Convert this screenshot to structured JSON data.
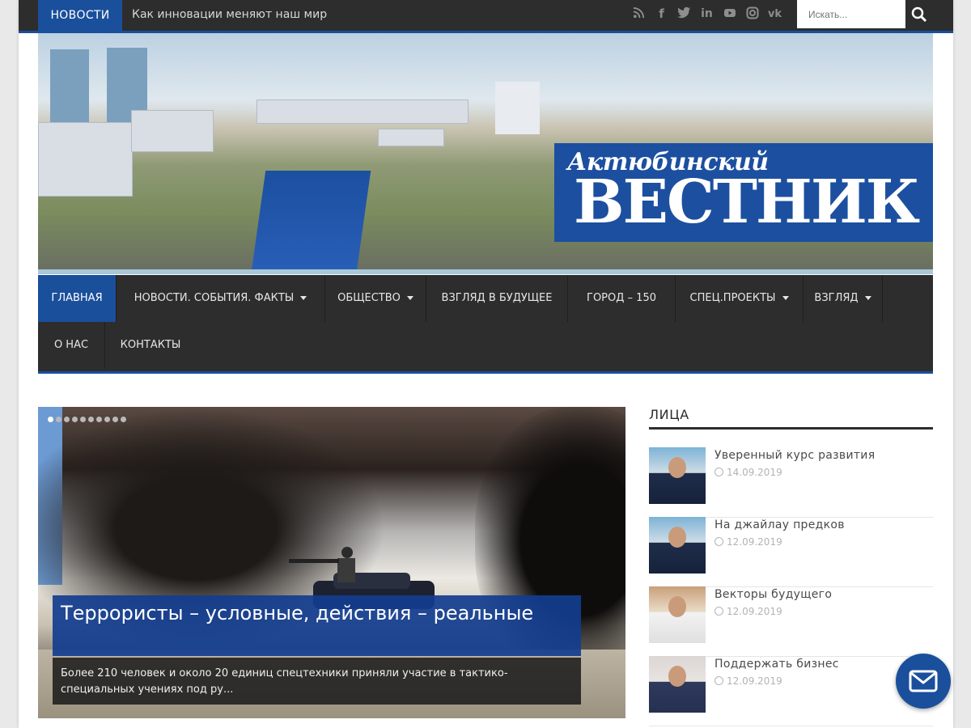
{
  "topbar": {
    "news_label": "НОВОСТИ",
    "ticker_text": "Как инновации меняют наш мир",
    "social_icons": [
      "rss-icon",
      "facebook-icon",
      "twitter-icon",
      "linkedin-icon",
      "youtube-icon",
      "instagram-icon",
      "vk-icon"
    ],
    "search_placeholder": "Искать..."
  },
  "brand": {
    "small": "Актюбинский",
    "big": "ВЕСТНИК",
    "color": "#1c4f9f"
  },
  "nav": {
    "items": [
      {
        "label": "ГЛАВНАЯ"
      },
      {
        "label": "НОВОСТИ. СОБЫТИЯ. ФАКТЫ"
      },
      {
        "label": "ОБЩЕСТВО"
      },
      {
        "label": "ВЗГЛЯД В БУДУЩЕЕ"
      },
      {
        "label": "ГОРОД – 150"
      },
      {
        "label": "СПЕЦ.ПРОЕКТЫ"
      },
      {
        "label": "ВЗГЛЯД"
      },
      {
        "label": "О НАС"
      },
      {
        "label": "КОНТАКТЫ"
      }
    ]
  },
  "slider": {
    "title": "Террористы – условные, действия – реальные",
    "excerpt": "Более 210 человек и около 20 единиц спецтехники приняли участие в тактико-специальных учениях под ру..."
  },
  "sidebar": {
    "title": "ЛИЦА",
    "items": [
      {
        "headline": "Уверенный курс развития",
        "date": "14.09.2019"
      },
      {
        "headline": "На джайлау предков",
        "date": "12.09.2019"
      },
      {
        "headline": "Векторы будущего",
        "date": "12.09.2019"
      },
      {
        "headline": "Поддержать бизнес",
        "date": "12.09.2019"
      }
    ]
  },
  "colors": {
    "accent": "#1a4f9c",
    "dark": "#2d2d2d"
  }
}
